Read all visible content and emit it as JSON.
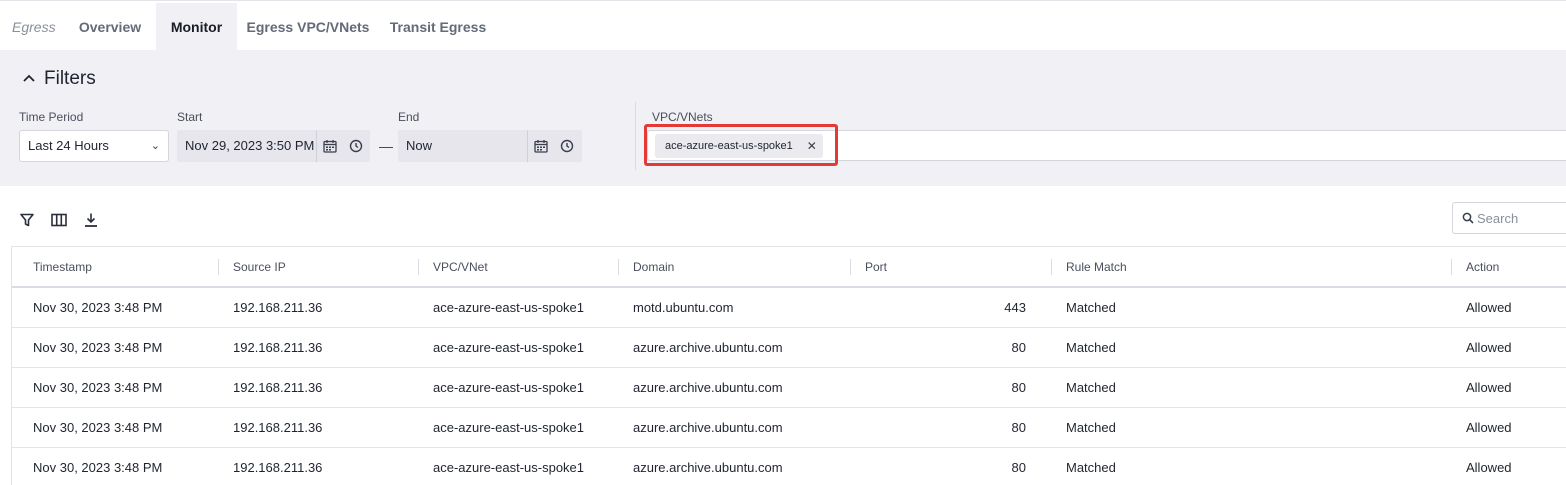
{
  "tabs": {
    "crumb": "Egress",
    "items": [
      {
        "label": "Overview",
        "active": false
      },
      {
        "label": "Monitor",
        "active": true
      },
      {
        "label": "Egress VPC/VNets",
        "active": false
      },
      {
        "label": "Transit Egress",
        "active": false
      }
    ]
  },
  "filters": {
    "title": "Filters",
    "time_period": {
      "label": "Time Period",
      "value": "Last 24 Hours"
    },
    "start": {
      "label": "Start",
      "value": "Nov 29, 2023 3:50 PM"
    },
    "end": {
      "label": "End",
      "value": "Now"
    },
    "range_separator": "—",
    "vpc": {
      "label": "VPC/VNets",
      "chips": [
        "ace-azure-east-us-spoke1"
      ]
    }
  },
  "toolbar": {
    "icons": [
      "filter-icon",
      "columns-icon",
      "download-icon"
    ],
    "search_placeholder": "Search"
  },
  "table": {
    "columns": [
      "Timestamp",
      "Source IP",
      "VPC/VNet",
      "Domain",
      "Port",
      "Rule Match",
      "Action"
    ],
    "rows": [
      [
        "Nov 30, 2023 3:48 PM",
        "192.168.211.36",
        "ace-azure-east-us-spoke1",
        "motd.ubuntu.com",
        "443",
        "Matched",
        "Allowed"
      ],
      [
        "Nov 30, 2023 3:48 PM",
        "192.168.211.36",
        "ace-azure-east-us-spoke1",
        "azure.archive.ubuntu.com",
        "80",
        "Matched",
        "Allowed"
      ],
      [
        "Nov 30, 2023 3:48 PM",
        "192.168.211.36",
        "ace-azure-east-us-spoke1",
        "azure.archive.ubuntu.com",
        "80",
        "Matched",
        "Allowed"
      ],
      [
        "Nov 30, 2023 3:48 PM",
        "192.168.211.36",
        "ace-azure-east-us-spoke1",
        "azure.archive.ubuntu.com",
        "80",
        "Matched",
        "Allowed"
      ],
      [
        "Nov 30, 2023 3:48 PM",
        "192.168.211.36",
        "ace-azure-east-us-spoke1",
        "azure.archive.ubuntu.com",
        "80",
        "Matched",
        "Allowed"
      ]
    ]
  },
  "colors": {
    "highlight": "#e53935",
    "panel_bg": "#f0f0f5"
  }
}
